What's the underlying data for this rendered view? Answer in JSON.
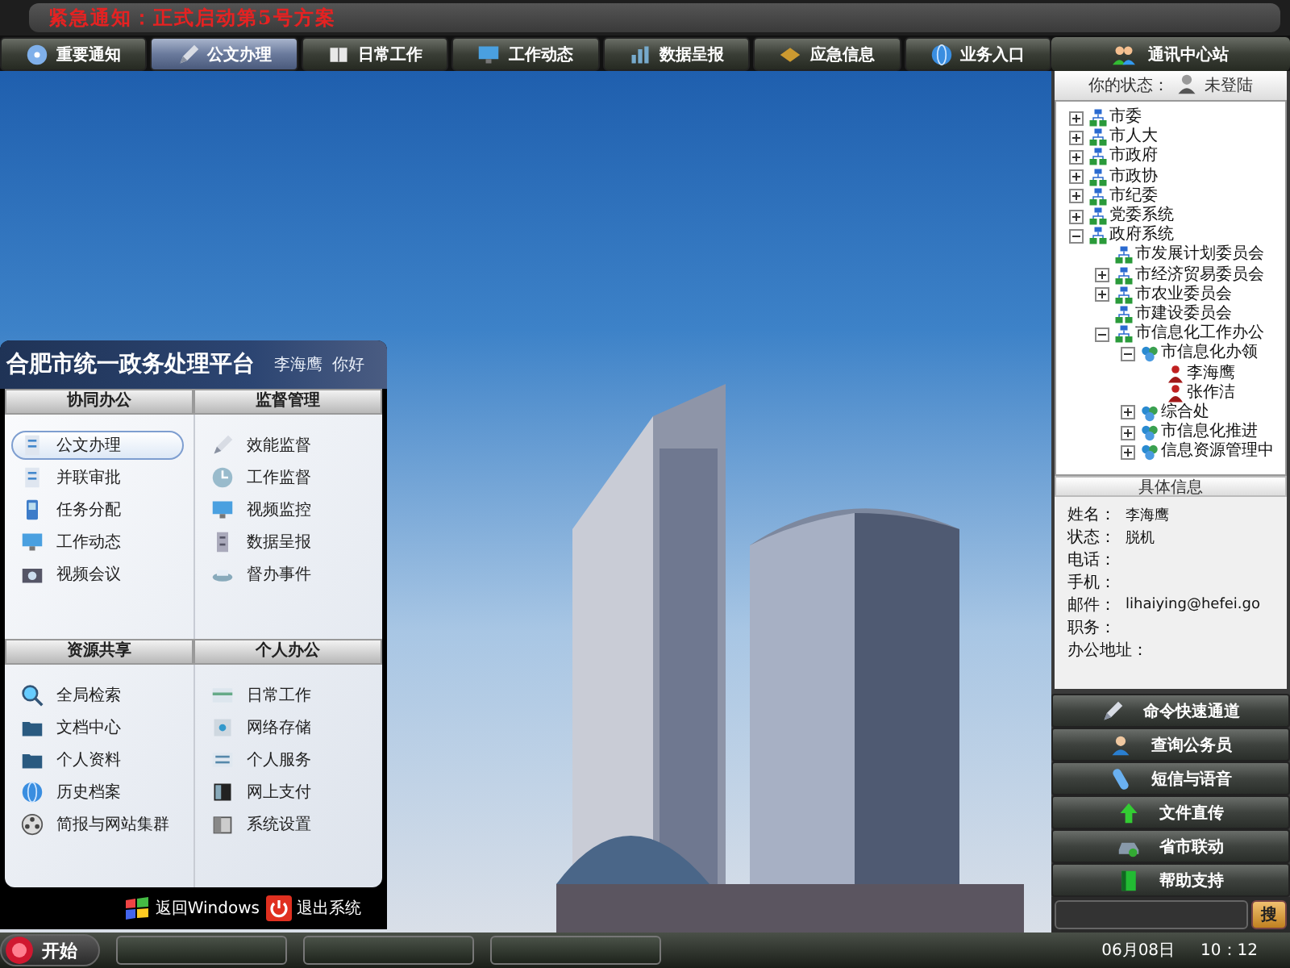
{
  "notice": {
    "text": "紧急通知：正式启动第5号方案"
  },
  "nav_tabs": [
    {
      "label": "重要通知",
      "selected": false
    },
    {
      "label": "公文办理",
      "selected": true
    },
    {
      "label": "日常工作",
      "selected": false
    },
    {
      "label": "工作动态",
      "selected": false
    },
    {
      "label": "数据呈报",
      "selected": false
    },
    {
      "label": "应急信息",
      "selected": false
    },
    {
      "label": "业务入口",
      "selected": false
    }
  ],
  "comm_panel": {
    "title": "通讯中心站",
    "status_label": "你的状态：",
    "status_value": "未登陆",
    "tree": [
      {
        "label": "市委",
        "kind": "org",
        "expanded": false
      },
      {
        "label": "市人大",
        "kind": "org",
        "expanded": false
      },
      {
        "label": "市政府",
        "kind": "org",
        "expanded": false
      },
      {
        "label": "市政协",
        "kind": "org",
        "expanded": false
      },
      {
        "label": "市纪委",
        "kind": "org",
        "expanded": false
      },
      {
        "label": "党委系统",
        "kind": "org",
        "expanded": false
      },
      {
        "label": "政府系统",
        "kind": "org",
        "expanded": true,
        "children": [
          {
            "label": "市发展计划委员会",
            "kind": "org"
          },
          {
            "label": "市经济贸易委员会",
            "kind": "org",
            "expanded": false
          },
          {
            "label": "市农业委员会",
            "kind": "org",
            "expanded": false
          },
          {
            "label": "市建设委员会",
            "kind": "org"
          },
          {
            "label": "市信息化工作办公",
            "kind": "org",
            "expanded": true,
            "children": [
              {
                "label": "市信息化办领",
                "kind": "group",
                "expanded": true,
                "children": [
                  {
                    "label": "李海鹰",
                    "kind": "person"
                  },
                  {
                    "label": "张作洁",
                    "kind": "person"
                  }
                ]
              },
              {
                "label": "综合处",
                "kind": "group",
                "expanded": false
              },
              {
                "label": "市信息化推进",
                "kind": "group",
                "expanded": false
              },
              {
                "label": "信息资源管理中",
                "kind": "group",
                "expanded": false
              }
            ]
          }
        ]
      }
    ],
    "info": {
      "title": "具体信息",
      "fields": [
        {
          "label": "姓名：",
          "value": "李海鹰"
        },
        {
          "label": "状态：",
          "value": "脱机"
        },
        {
          "label": "电话："
        },
        {
          "label": "手机："
        },
        {
          "label": "邮件：",
          "value": "lihaiying@hefei.go"
        },
        {
          "label": "职务："
        },
        {
          "label": "办公地址："
        }
      ]
    },
    "buttons": [
      "命令快速通道",
      "查询公务员",
      "短信与语音",
      "文件直传",
      "省市联动",
      "帮助支持"
    ],
    "search_button": "搜"
  },
  "start_menu": {
    "title": "合肥市统一政务处理平台",
    "user": "李海鹰",
    "greeting": "你好",
    "sections": [
      {
        "title": "协同办公",
        "items": [
          {
            "label": "公文办理",
            "selected": true
          },
          {
            "label": "并联审批",
            "selected": false
          },
          {
            "label": "任务分配",
            "selected": false
          },
          {
            "label": "工作动态",
            "selected": false
          },
          {
            "label": "视频会议",
            "selected": false
          }
        ]
      },
      {
        "title": "监督管理",
        "items": [
          {
            "label": "效能监督",
            "selected": false
          },
          {
            "label": "工作监督",
            "selected": false
          },
          {
            "label": "视频监控",
            "selected": false
          },
          {
            "label": "数据呈报",
            "selected": false
          },
          {
            "label": "督办事件",
            "selected": false
          }
        ]
      },
      {
        "title": "资源共享",
        "items": [
          {
            "label": "全局检索",
            "selected": false
          },
          {
            "label": "文档中心",
            "selected": false
          },
          {
            "label": "个人资料",
            "selected": false
          },
          {
            "label": "历史档案",
            "selected": false
          },
          {
            "label": "简报与网站集群",
            "selected": false
          }
        ]
      },
      {
        "title": "个人办公",
        "items": [
          {
            "label": "日常工作",
            "selected": false
          },
          {
            "label": "网络存储",
            "selected": false
          },
          {
            "label": "个人服务",
            "selected": false
          },
          {
            "label": "网上支付",
            "selected": false
          },
          {
            "label": "系统设置",
            "selected": false
          }
        ]
      }
    ],
    "footer": [
      "返回Windows",
      "退出系统"
    ]
  },
  "taskbar": {
    "start": "开始",
    "date": "06月08日",
    "time": "10：12"
  }
}
